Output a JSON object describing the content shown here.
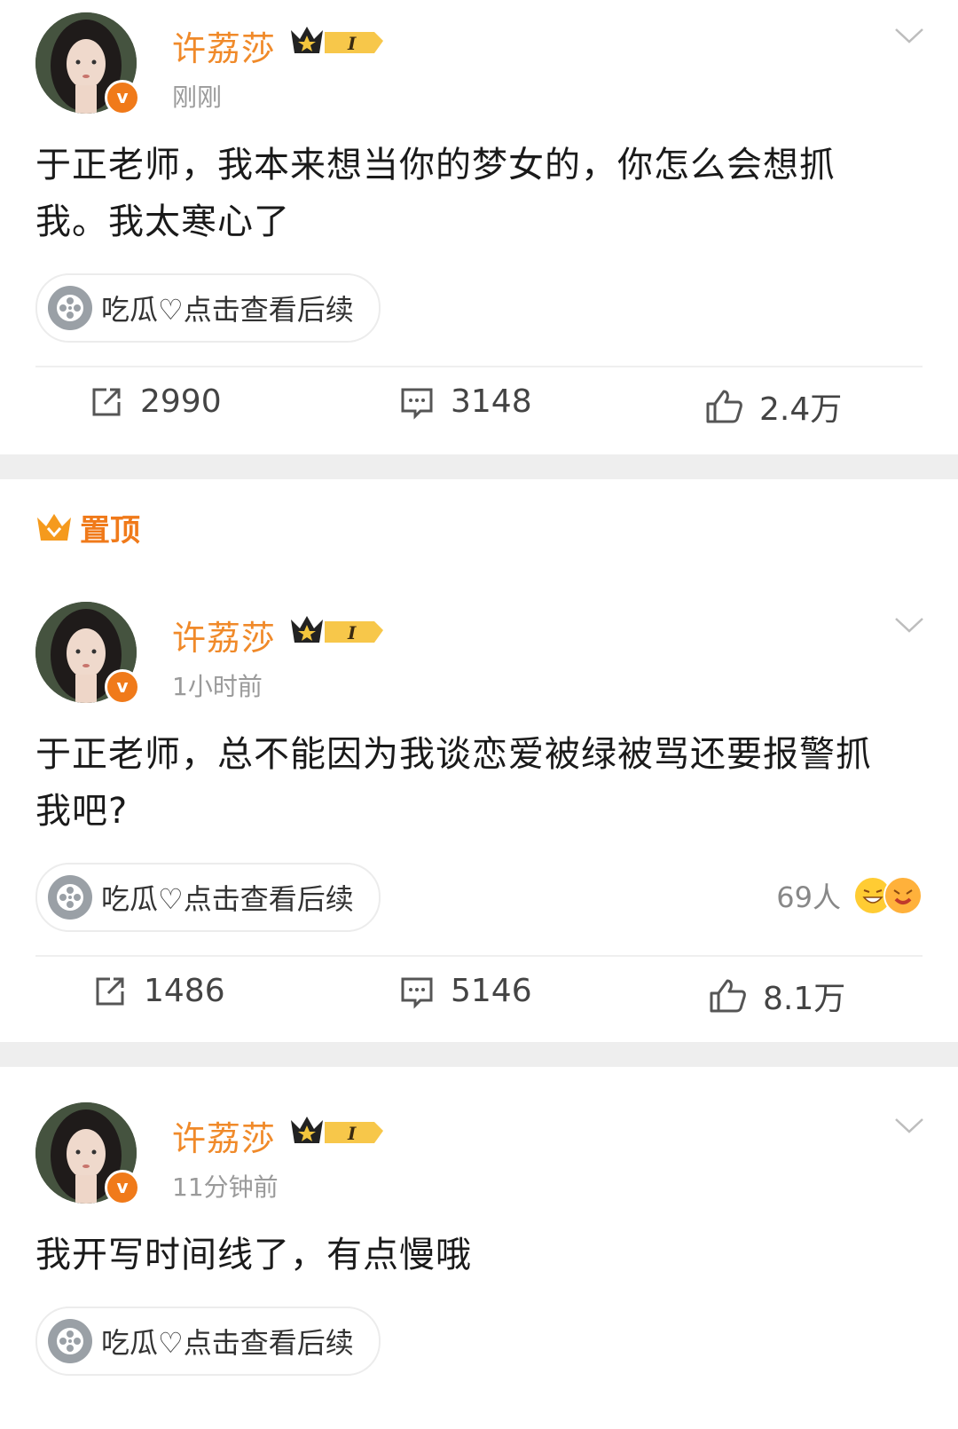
{
  "posts": [
    {
      "username": "许荔莎",
      "level": "I",
      "time": "刚刚",
      "content": "于正老师，我本来想当你的梦女的，你怎么会想抓我。我太寒心了",
      "topic": "吃瓜♡点击查看后续",
      "reposts": "2990",
      "comments": "3148",
      "likes": "2.4万"
    },
    {
      "pinned_label": "置顶",
      "username": "许荔莎",
      "level": "I",
      "time": "1小时前",
      "content": "于正老师，总不能因为我谈恋爱被绿被骂还要报警抓我吧?",
      "topic": "吃瓜♡点击查看后续",
      "reaction_count": "69人",
      "reposts": "1486",
      "comments": "5146",
      "likes": "8.1万"
    },
    {
      "username": "许荔莎",
      "level": "I",
      "time": "11分钟前",
      "content": "我开写时间线了，有点慢哦",
      "topic": "吃瓜♡点击查看后续"
    }
  ],
  "colors": {
    "accent": "#f08a2a",
    "badge": "#f07a1a",
    "separator": "#eeeeee"
  },
  "icons": [
    "avatar",
    "verified-badge",
    "crown-level-badge",
    "chevron-down-icon",
    "film-reel-icon",
    "repost-icon",
    "comment-icon",
    "like-icon",
    "crown-pin-icon",
    "emoji-icon"
  ]
}
